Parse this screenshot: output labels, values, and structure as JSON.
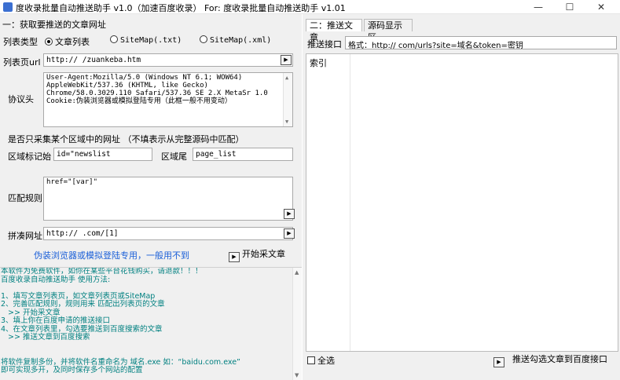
{
  "window": {
    "title": "度收录批量自动推送助手 v1.0（加速百度收录） For: 度收录批量自动推送助手 v1.01",
    "min_glyph": "—",
    "max_glyph": "☐",
    "close_glyph": "✕"
  },
  "left": {
    "section_title": "一：获取要推送的文章网址",
    "list_type_label": "列表类型",
    "list_type_options": [
      "文章列表",
      "SiteMap(.txt)",
      "SiteMap(.xml)"
    ],
    "list_url_label": "列表页url",
    "list_url_value": "http://            /zuankeba.htm",
    "protocol_label": "协议头",
    "protocol_lines": [
      "User-Agent:Mozilla/5.0 (Windows NT 6.1; WOW64)",
      "AppleWebKit/537.36 (KHTML, like Gecko)",
      "Chrome/58.0.3029.110 Safari/537.36 SE 2.X MetaSr 1.0",
      "Cookie:伪装浏览器或模拟登陆专用（此框一般不用变动）"
    ],
    "region_question": "是否只采集某个区域中的网址 （不填表示从完整源码中匹配）",
    "region_start_label": "区域标记始",
    "region_start_value": "id=\"newslist",
    "region_end_label": "区域尾",
    "region_end_value": "page_list",
    "match_rule_label": "匹配规则",
    "match_rule_value": "href=\"[var]\"",
    "concat_label": "拼凑网址",
    "concat_value": "http://       .com/[1]",
    "login_hint": "伪装浏览器或模拟登陆专用，一般用不到",
    "start_button": "开始采文章",
    "instructions": [
      "本软件为免费软件，如你在某些平台花钱购买，请退款！！！",
      "百度收录自动推送助手 使用方法:",
      "",
      "1、填写文章列表页，如文章列表页或SiteMap",
      "2、完善匹配规则，规则用来 匹配出列表页的文章",
      "   >> 开始采文章",
      "3、填上你在百度申请的推送接口",
      "4、在文章列表里，勾选要推送到百度搜索的文章",
      "   >> 推送文章到百度搜索",
      "",
      "",
      "将软件复制多份，并将软件名重命名为 域名.exe 如：“baidu.com.exe”",
      "即可实现多开，及同时保存多个网站的配置"
    ]
  },
  "right": {
    "tabs": [
      "二：推送文章",
      "源码显示区"
    ],
    "push_api_label": "推送接口",
    "push_api_value": "格式：http://             com/urls?site=域名&token=密钥",
    "column_header": "索引",
    "select_all": "全选",
    "push_button": "推送勾选文章到百度接口"
  },
  "icons": {
    "play": "▶"
  }
}
